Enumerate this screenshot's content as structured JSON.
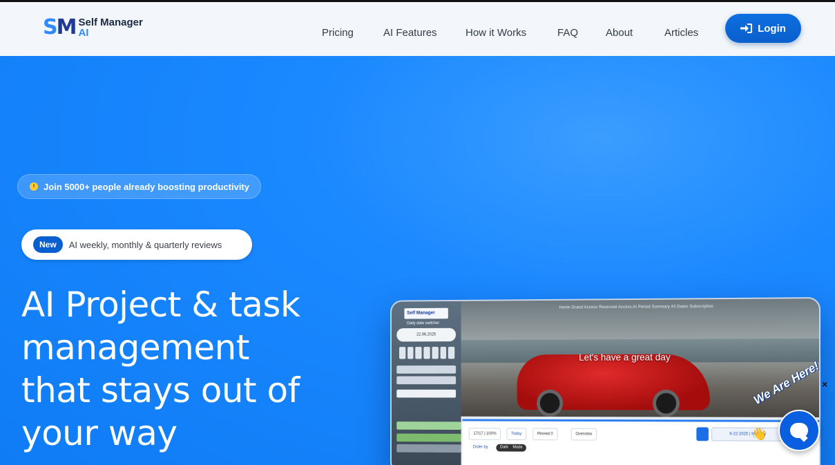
{
  "header": {
    "logo_mark_1": "S",
    "logo_mark_2": "M",
    "logo_line1": "Self Manager",
    "logo_line2": "AI",
    "nav": [
      {
        "label": "Pricing"
      },
      {
        "label": "AI Features"
      },
      {
        "label": "How it Works"
      },
      {
        "label": "FAQ"
      },
      {
        "label": "About"
      },
      {
        "label": "Articles"
      }
    ],
    "login_label": "Login",
    "login_icon": "sign-in-icon"
  },
  "hero": {
    "join_badge": "Join 5000+ people already boosting productivity",
    "new_pill": "New",
    "new_text": "AI weekly, monthly & quarterly reviews",
    "title": "AI Project & task management that stays out of your way"
  },
  "mockup": {
    "greeting": "Let's have a great day",
    "side_date_label": "Daily date switcher",
    "side_date": "22.06.2025",
    "topnav": "Home   Grand Access   Reserved Access   AI Period Summary   All Dates   Subscription",
    "btn_count": "17/17 | 100%",
    "btn_today": "Today",
    "btn_pinned": "Pinned 0",
    "btn_overview": "Overview",
    "date_field": "6-22-2025 | Monday",
    "order_by": "Order by",
    "mode_dark": "Dark",
    "mode_label": "Mode"
  },
  "chat": {
    "close": "×",
    "label": "We Are Here!",
    "icon": "chat-bubble-icon"
  },
  "colors": {
    "brand": "#0a5fd0",
    "hero_bg": "#1a8cff",
    "accent_yellow": "#ffcc33"
  }
}
